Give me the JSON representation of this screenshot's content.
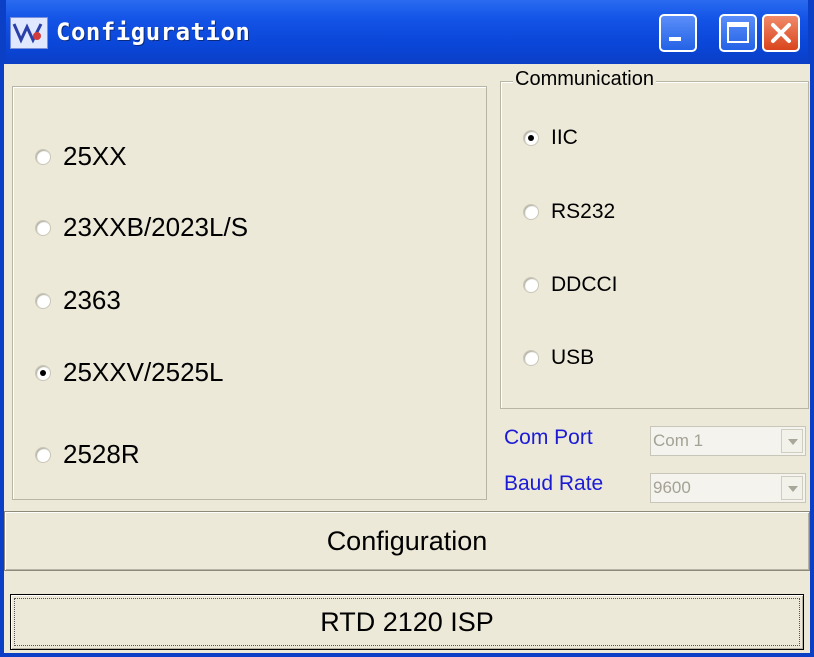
{
  "window": {
    "title": "Configuration",
    "icon": "app-logo-icon",
    "controls": [
      "minimize-icon",
      "maximize-icon",
      "close-icon"
    ],
    "title_gradient": "#0a46d8",
    "close_color": "#d9451c"
  },
  "device_group": {
    "options": [
      {
        "label": "25XX",
        "checked": false
      },
      {
        "label": "23XXB/2023L/S",
        "checked": false
      },
      {
        "label": "2363",
        "checked": false
      },
      {
        "label": "25XXV/2525L",
        "checked": true
      },
      {
        "label": "2528R",
        "checked": false
      }
    ]
  },
  "communication": {
    "title": "Communication",
    "options": [
      {
        "label": "IIC",
        "checked": true
      },
      {
        "label": "RS232",
        "checked": false
      },
      {
        "label": "DDCCI",
        "checked": false
      },
      {
        "label": "USB",
        "checked": false
      }
    ]
  },
  "com_port": {
    "label": "Com Port",
    "value": "Com 1"
  },
  "baud_rate": {
    "label": "Baud Rate",
    "value": "9600"
  },
  "label_color": "#1b1bd6",
  "buttons": {
    "configuration": "Configuration",
    "isp": "RTD 2120 ISP"
  }
}
